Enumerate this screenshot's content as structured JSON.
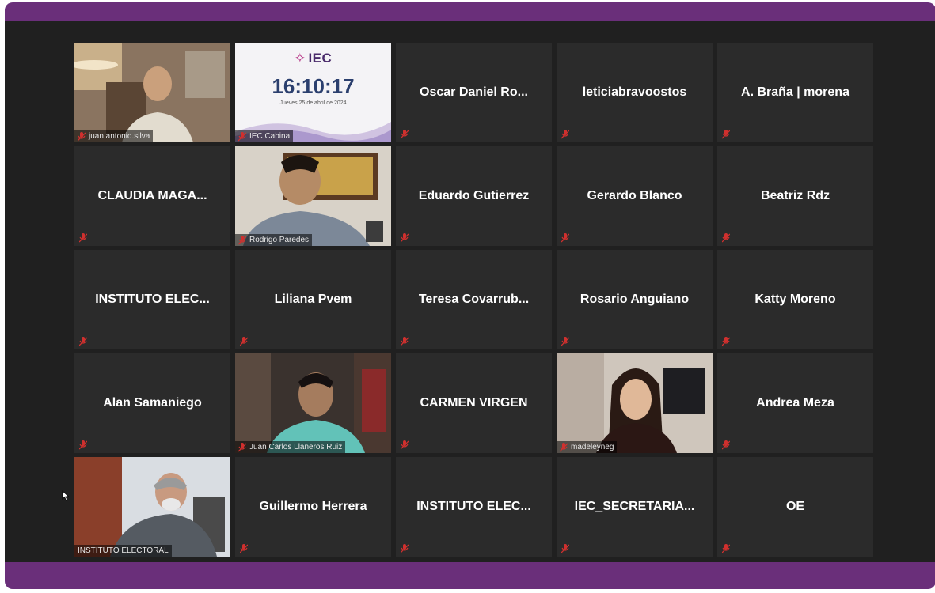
{
  "meeting": {
    "participants": [
      {
        "id": "p1",
        "name": "juan.antonio.silva",
        "kind": "video"
      },
      {
        "id": "p2",
        "name": "IEC Cabina",
        "kind": "clock"
      },
      {
        "id": "p3",
        "name": "Oscar Daniel Ro...",
        "kind": "name"
      },
      {
        "id": "p4",
        "name": "leticiabravoostos",
        "kind": "name"
      },
      {
        "id": "p5",
        "name": "A. Braña | morena",
        "kind": "name"
      },
      {
        "id": "p6",
        "name": "CLAUDIA MAGA...",
        "kind": "name"
      },
      {
        "id": "p7",
        "name": "Rodrigo Paredes",
        "kind": "video"
      },
      {
        "id": "p8",
        "name": "Eduardo Gutierrez",
        "kind": "name"
      },
      {
        "id": "p9",
        "name": "Gerardo Blanco",
        "kind": "name"
      },
      {
        "id": "p10",
        "name": "Beatriz Rdz",
        "kind": "name"
      },
      {
        "id": "p11",
        "name": "INSTITUTO ELEC...",
        "kind": "name"
      },
      {
        "id": "p12",
        "name": "Liliana Pvem",
        "kind": "name"
      },
      {
        "id": "p13",
        "name": "Teresa Covarrub...",
        "kind": "name"
      },
      {
        "id": "p14",
        "name": "Rosario Anguiano",
        "kind": "name"
      },
      {
        "id": "p15",
        "name": "Katty Moreno",
        "kind": "name"
      },
      {
        "id": "p16",
        "name": "Alan Samaniego",
        "kind": "name"
      },
      {
        "id": "p17",
        "name": "Juan Carlos Llaneros Ruiz",
        "kind": "video"
      },
      {
        "id": "p18",
        "name": "CARMEN VIRGEN",
        "kind": "name"
      },
      {
        "id": "p19",
        "name": "madeleyneg",
        "kind": "video",
        "active": true
      },
      {
        "id": "p20",
        "name": "Andrea Meza",
        "kind": "name"
      },
      {
        "id": "p21",
        "name": "INSTITUTO ELECTORAL",
        "kind": "video"
      },
      {
        "id": "p22",
        "name": "Guillermo Herrera",
        "kind": "name"
      },
      {
        "id": "p23",
        "name": "INSTITUTO ELEC...",
        "kind": "name"
      },
      {
        "id": "p24",
        "name": "IEC_SECRETARIA...",
        "kind": "name"
      },
      {
        "id": "p25",
        "name": "OE",
        "kind": "name"
      }
    ]
  },
  "clock": {
    "logo": "IEC",
    "time": "16:10:17",
    "date": "Jueves 25 de abril de 2024"
  },
  "colors": {
    "frame": "#6a2f7a",
    "stage": "#202020",
    "tile": "#2b2b2b",
    "active_speaker_border": "#b7e34a",
    "muted_mic": "#d0302e"
  },
  "icons": {
    "muted": "microphone-muted-icon",
    "pointer": "mouse-pointer-icon"
  }
}
